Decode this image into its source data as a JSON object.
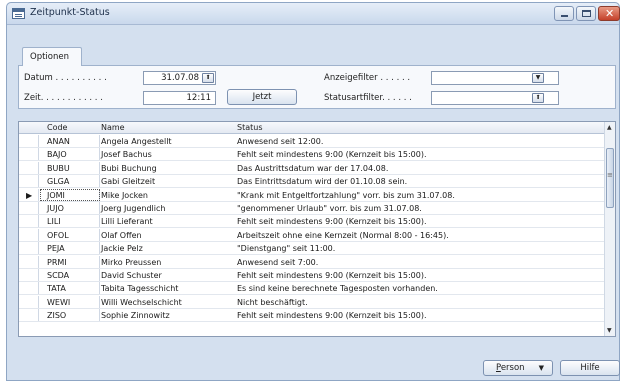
{
  "window": {
    "title": "Zeitpunkt-Status"
  },
  "tabs": [
    {
      "label": "Optionen"
    }
  ],
  "options": {
    "datum_label": "Datum . . . . . . . . . .",
    "datum_value": "31.07.08",
    "zeit_label": "Zeit. . . . . . . . . . . .",
    "zeit_value": "12:11",
    "jetzt_label": "Jetzt",
    "anzeigefilter_label": "Anzeigefilter . . . . . .",
    "anzeigefilter_value": "",
    "statusartfilter_label": "Statusartfilter. . . . . .",
    "statusartfilter_value": ""
  },
  "table": {
    "columns": [
      "Code",
      "Name",
      "Status"
    ],
    "selected_index": 4,
    "rows": [
      {
        "code": "ANAN",
        "name": "Angela Angestellt",
        "status": "Anwesend seit 12:00."
      },
      {
        "code": "BAJO",
        "name": "Josef Bachus",
        "status": "Fehlt seit mindestens 9:00 (Kernzeit bis 15:00)."
      },
      {
        "code": "BUBU",
        "name": "Bubi Buchung",
        "status": "Das Austrittsdatum war der 17.04.08."
      },
      {
        "code": "GLGA",
        "name": "Gabi Gleitzeit",
        "status": "Das Eintrittsdatum wird der 01.10.08 sein."
      },
      {
        "code": "JOMI",
        "name": "Mike Jocken",
        "status": "\"Krank mit Entgeltfortzahlung\" vorr. bis zum 31.07.08."
      },
      {
        "code": "JUJO",
        "name": "Joerg Jugendlich",
        "status": "\"genommener Urlaub\" vorr. bis zum 31.07.08."
      },
      {
        "code": "LILI",
        "name": "Lilli Lieferant",
        "status": "Fehlt seit mindestens 9:00 (Kernzeit bis 15:00)."
      },
      {
        "code": "OFOL",
        "name": "Olaf Offen",
        "status": "Arbeitszeit ohne eine Kernzeit (Normal 8:00 - 16:45)."
      },
      {
        "code": "PEJA",
        "name": "Jackie Pelz",
        "status": "\"Dienstgang\" seit 11:00."
      },
      {
        "code": "PRMI",
        "name": "Mirko Preussen",
        "status": "Anwesend seit 7:00."
      },
      {
        "code": "SCDA",
        "name": "David Schuster",
        "status": "Fehlt seit mindestens 9:00 (Kernzeit bis 15:00)."
      },
      {
        "code": "TATA",
        "name": "Tabita Tagesschicht",
        "status": "Es sind keine berechnete Tagesposten vorhanden."
      },
      {
        "code": "WEWI",
        "name": "Willi Wechselschicht",
        "status": "Nicht beschäftigt."
      },
      {
        "code": "ZISO",
        "name": "Sophie Zinnowitz",
        "status": "Fehlt seit mindestens 9:00 (Kernzeit bis 15:00)."
      }
    ]
  },
  "buttons": {
    "person": "Person",
    "hilfe": "Hilfe"
  },
  "colors": {
    "title_bar": "#c9d8ec",
    "close_button": "#c4402a",
    "window_bg": "#d4e0ef"
  }
}
